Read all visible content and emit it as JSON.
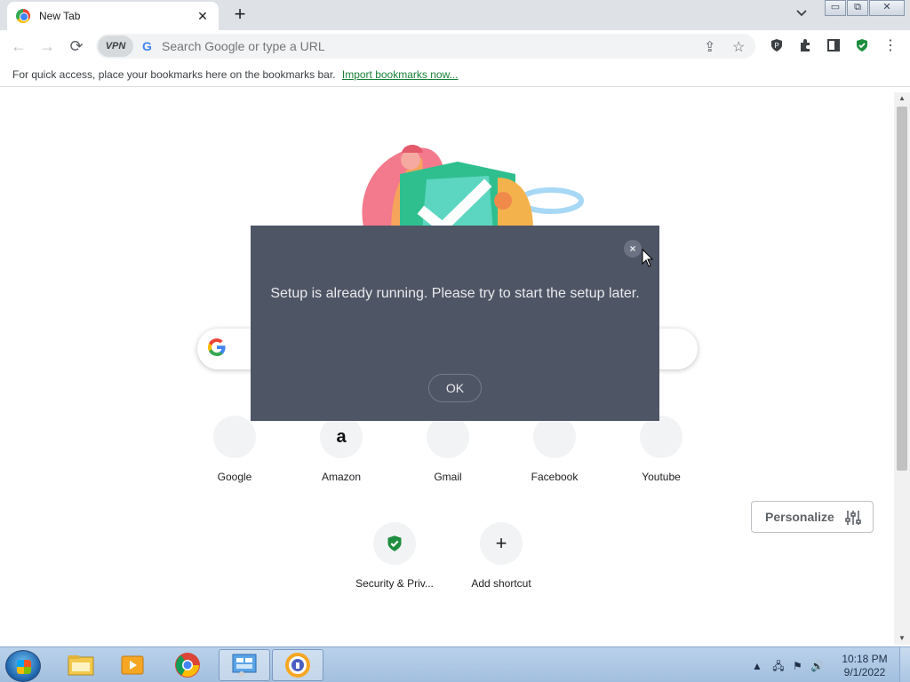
{
  "browser": {
    "tab_title": "New Tab",
    "tab_close_glyph": "✕",
    "new_tab_glyph": "+",
    "omnibox_placeholder": "Search Google or type a URL",
    "vpn_label": "VPN",
    "g_letter": "G"
  },
  "bookmarks_bar": {
    "message": "For quick access, place your bookmarks here on the bookmarks bar.",
    "import_link": "Import bookmarks now..."
  },
  "shortcuts": [
    {
      "label": "Google",
      "icon": "google-icon"
    },
    {
      "label": "Amazon",
      "icon": "amazon-icon",
      "glyph": "a"
    },
    {
      "label": "Gmail",
      "icon": "gmail-icon"
    },
    {
      "label": "Facebook",
      "icon": "facebook-icon"
    },
    {
      "label": "Youtube",
      "icon": "youtube-icon"
    },
    {
      "label": "Security & Priv...",
      "icon": "shield-check-icon"
    },
    {
      "label": "Add shortcut",
      "icon": "plus-icon",
      "glyph": "+"
    }
  ],
  "personalize_label": "Personalize",
  "dialog": {
    "message": "Setup is already running. Please try to start the setup later.",
    "ok_label": "OK",
    "close_glyph": "×"
  },
  "taskbar": {
    "time": "10:18 PM",
    "date": "9/1/2022"
  },
  "colors": {
    "dialog_bg": "#4e5565",
    "accent_link": "#188038",
    "taskbar": "#a3bfdf"
  }
}
